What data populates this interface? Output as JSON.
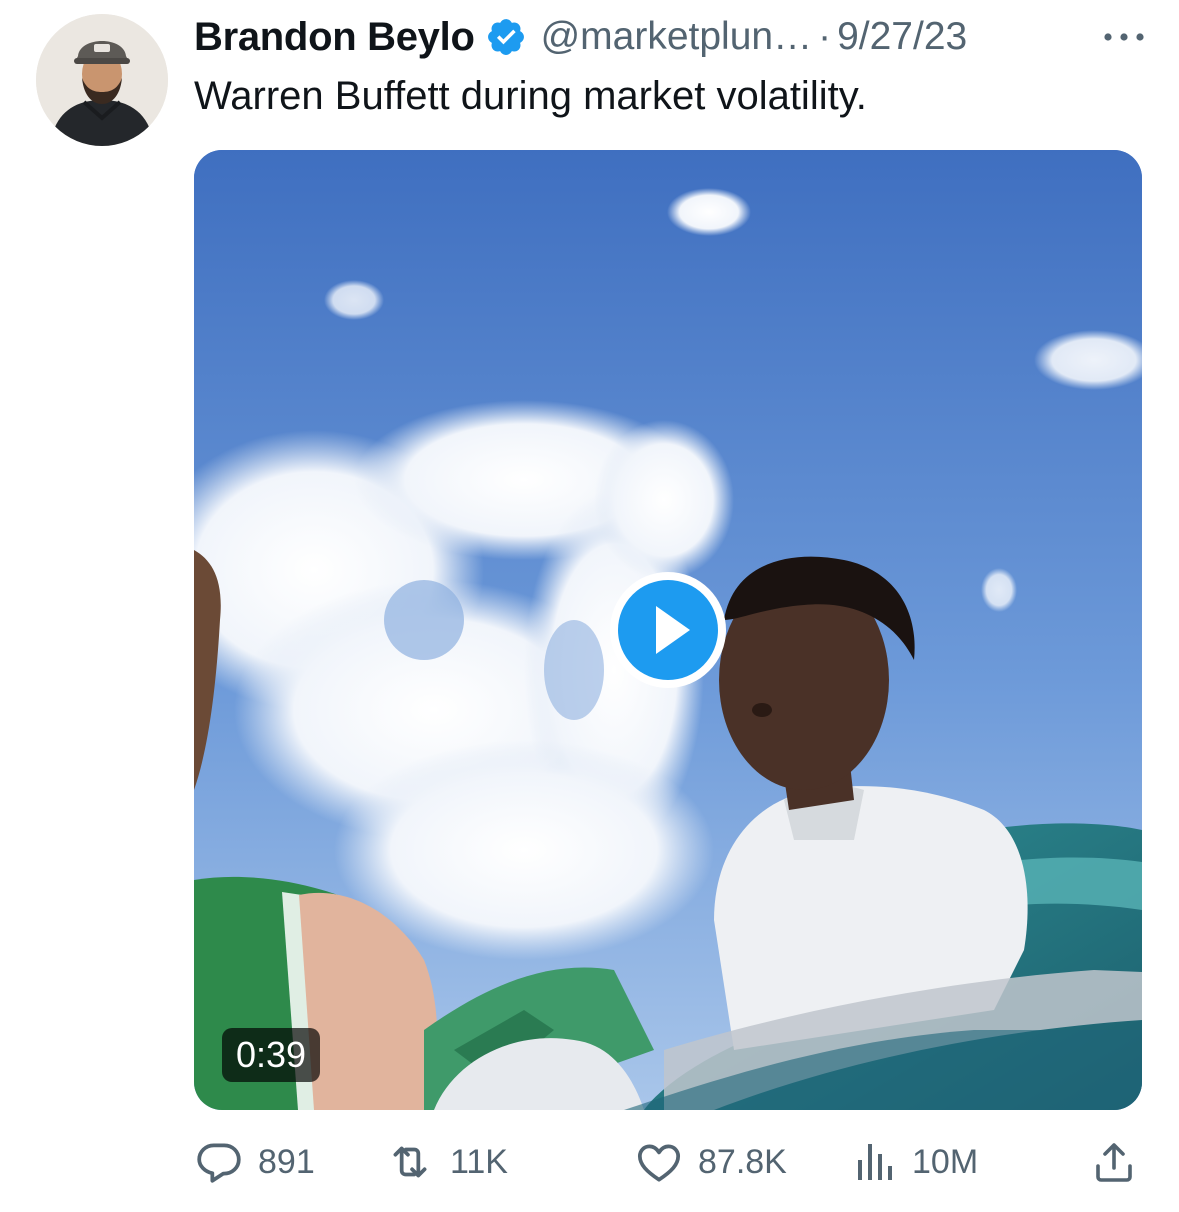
{
  "tweet": {
    "display_name": "Brandon Beylo",
    "handle": "@marketplun…",
    "separator": "·",
    "date": "9/27/23",
    "text": "Warren Buffett during market volatility.",
    "verified_color": "#1d9bf0"
  },
  "media": {
    "type": "video",
    "duration": "0:39",
    "play_color": "#1d9bf0"
  },
  "actions": {
    "replies": "891",
    "reposts": "11K",
    "likes": "87.8K",
    "views": "10M"
  },
  "icons": {
    "more": "more-horizontal-icon",
    "reply": "comment-bubble-icon",
    "repost": "repost-arrows-icon",
    "like": "heart-icon",
    "views": "bar-chart-icon",
    "share": "share-upload-icon"
  },
  "colors": {
    "text_primary": "#0f1419",
    "text_secondary": "#536471",
    "accent": "#1d9bf0"
  }
}
